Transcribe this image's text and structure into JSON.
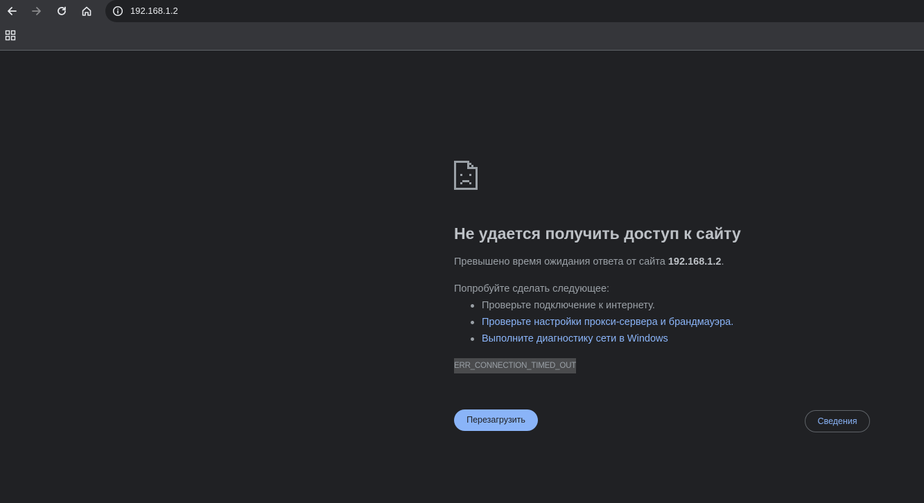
{
  "browser": {
    "back_icon": "arrow-left-icon",
    "forward_icon": "arrow-right-icon",
    "reload_icon": "reload-icon",
    "home_icon": "home-icon",
    "info_icon": "info-icon",
    "url": "192.168.1.2",
    "apps_icon": "apps-grid-icon"
  },
  "error_page": {
    "icon": "sad-document-icon",
    "title": "Не удается получить доступ к сайту",
    "description_prefix": "Превышено время ожидания ответа от сайта ",
    "description_host": "192.168.1.2",
    "description_suffix": ".",
    "suggestions_heading": "Попробуйте сделать следующее:",
    "suggestions": [
      {
        "text": "Проверьте подключение к интернету.",
        "link": false
      },
      {
        "text": "Проверьте настройки прокси-сервера и брандмауэра.",
        "link": true
      },
      {
        "text": "Выполните диагностику сети в Windows",
        "link": true
      }
    ],
    "error_code": "ERR_CONNECTION_TIMED_OUT",
    "reload_button": "Перезагрузить",
    "details_button": "Сведения"
  },
  "colors": {
    "background": "#202124",
    "toolbar": "#35363a",
    "title_text": "#bdc1c6",
    "body_text": "#9aa0a6",
    "link": "#8ab4f8",
    "primary_button": "#8ab4f8"
  }
}
